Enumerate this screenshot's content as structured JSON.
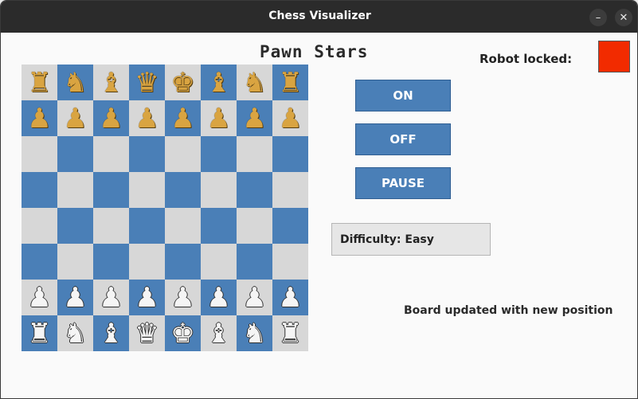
{
  "window": {
    "title": "Chess Visualizer",
    "minimize_glyph": "–",
    "close_glyph": "✕"
  },
  "app": {
    "title": "Pawn Stars"
  },
  "board": {
    "light_color": "#d7d7d7",
    "dark_color": "#4a7fb7",
    "black_piece_color": "#d9a441",
    "white_piece_color": "#f5f5f5",
    "rows": [
      [
        "r",
        "n",
        "b",
        "q",
        "k",
        "b",
        "n",
        "r"
      ],
      [
        "p",
        "p",
        "p",
        "p",
        "p",
        "p",
        "p",
        "p"
      ],
      [
        "",
        "",
        "",
        "",
        "",
        "",
        "",
        ""
      ],
      [
        "",
        "",
        "",
        "",
        "",
        "",
        "",
        ""
      ],
      [
        "",
        "",
        "",
        "",
        "",
        "",
        "",
        ""
      ],
      [
        "",
        "",
        "",
        "",
        "",
        "",
        "",
        ""
      ],
      [
        "P",
        "P",
        "P",
        "P",
        "P",
        "P",
        "P",
        "P"
      ],
      [
        "R",
        "N",
        "B",
        "Q",
        "K",
        "B",
        "N",
        "R"
      ]
    ]
  },
  "controls": {
    "on_label": "ON",
    "off_label": "OFF",
    "pause_label": "PAUSE"
  },
  "robot": {
    "label": "Robot locked:",
    "indicator_color": "#f22b00"
  },
  "difficulty": {
    "label": "Difficulty: Easy"
  },
  "status": {
    "message": "Board updated with new position"
  }
}
